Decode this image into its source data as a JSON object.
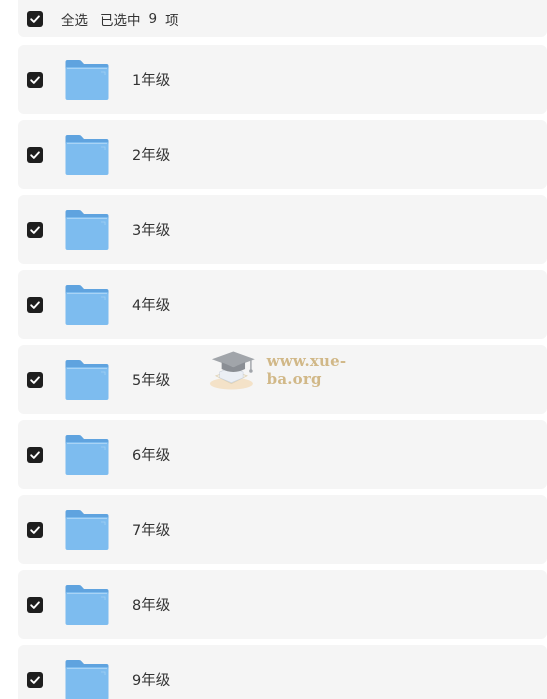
{
  "header": {
    "select_all_label": "全选",
    "selected_label": "已选中",
    "selected_count": "9",
    "selected_unit": "项"
  },
  "folders": [
    {
      "label": "1年级"
    },
    {
      "label": "2年级"
    },
    {
      "label": "3年级"
    },
    {
      "label": "4年级"
    },
    {
      "label": "5年级"
    },
    {
      "label": "6年级"
    },
    {
      "label": "7年级"
    },
    {
      "label": "8年级"
    },
    {
      "label": "9年级"
    }
  ],
  "watermark": {
    "text": "www.xue-ba.org"
  },
  "colors": {
    "checkbox": "#1f1f1f",
    "folder": "#6fb2e8",
    "row_background": "#f5f5f5"
  },
  "icons": {
    "checkbox": "checked-checkbox-icon",
    "folder": "folder-icon",
    "watermark_logo": "graduation-cap-icon"
  }
}
